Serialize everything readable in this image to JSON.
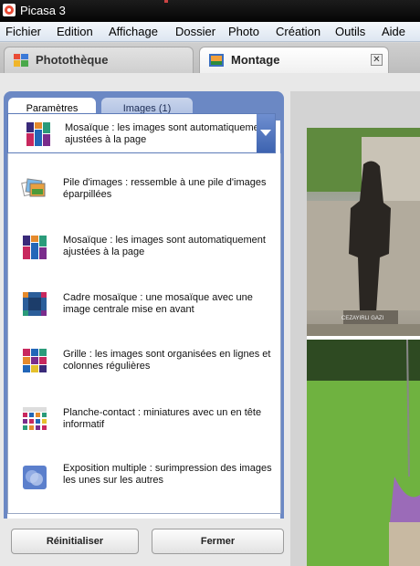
{
  "window": {
    "title": "Picasa 3"
  },
  "menu": [
    "Fichier",
    "Edition",
    "Affichage",
    "Dossier",
    "Photo",
    "Création",
    "Outils",
    "Aide"
  ],
  "top_tabs": {
    "library": "Photothèque",
    "montage": "Montage"
  },
  "panel_tabs": {
    "params": "Paramètres",
    "images": "Images (1)"
  },
  "dropdown": {
    "selected": "Mosaïque : les images sont automatiquement ajustées à la page",
    "options": [
      {
        "label": "Pile d'images : ressemble à une pile d'images éparpillées",
        "icon": "stack-icon"
      },
      {
        "label": "Mosaïque : les images sont automatiquement ajustées à la page",
        "icon": "mosaic-icon"
      },
      {
        "label": "Cadre mosaïque : une mosaïque avec une image centrale mise en avant",
        "icon": "frame-mosaic-icon"
      },
      {
        "label": "Grille : les images sont organisées en lignes et colonnes régulières",
        "icon": "grid-icon"
      },
      {
        "label": "Planche-contact : miniatures avec un en tête informatif",
        "icon": "contact-sheet-icon"
      },
      {
        "label": "Exposition multiple : surimpression des images les unes sur les autres",
        "icon": "multiple-exposure-icon"
      }
    ]
  },
  "buttons": {
    "reset": "Réinitialiser",
    "close": "Fermer"
  },
  "photo_caption": "CEZAYIRLI GAZI",
  "colors": {
    "panel": "#6b88c4",
    "dropdown_arrow": "#3d63b0",
    "titlebar": "#0a0a0a"
  }
}
